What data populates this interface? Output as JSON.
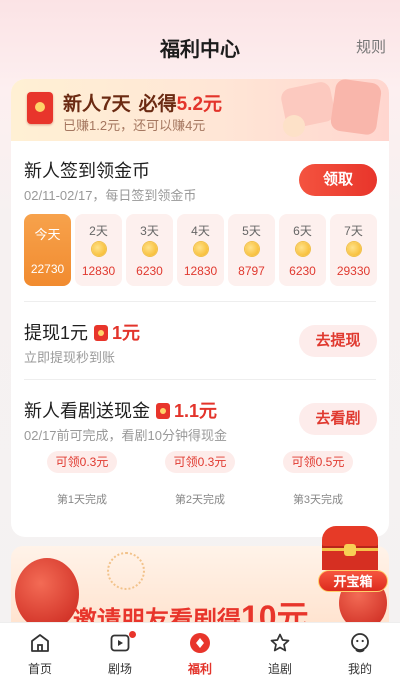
{
  "header": {
    "title": "福利中心",
    "rules": "规则"
  },
  "banner": {
    "line1_prefix": "新人7天",
    "line1_mid": "必得",
    "line1_amount": "5.2元",
    "line2": "已赚1.2元，还可以赚4元"
  },
  "signin": {
    "title": "新人签到领金币",
    "subtitle": "02/11-02/17，每日签到领金币",
    "button": "领取",
    "days": [
      {
        "day": "今天",
        "value": "22730"
      },
      {
        "day": "2天",
        "value": "12830"
      },
      {
        "day": "3天",
        "value": "6230"
      },
      {
        "day": "4天",
        "value": "12830"
      },
      {
        "day": "5天",
        "value": "8797"
      },
      {
        "day": "6天",
        "value": "6230"
      },
      {
        "day": "7天",
        "value": "29330"
      }
    ]
  },
  "withdraw": {
    "title": "提现1元",
    "amount": "1元",
    "subtitle": "立即提现秒到账",
    "button": "去提现"
  },
  "watch": {
    "title": "新人看剧送现金",
    "amount": "1.1元",
    "subtitle": "02/17前可完成，看剧10分钟得现金",
    "button": "去看剧",
    "steps": [
      {
        "reward": "可领0.3元",
        "label": "第1天完成"
      },
      {
        "reward": "可领0.3元",
        "label": "第2天完成"
      },
      {
        "reward": "可领0.5元",
        "label": "第3天完成"
      }
    ]
  },
  "invite": {
    "text": "邀请朋友看剧得",
    "amount": "10元"
  },
  "treasure": {
    "label": "开宝箱"
  },
  "tabs": [
    {
      "label": "首页",
      "icon": "home-icon"
    },
    {
      "label": "剧场",
      "icon": "theater-icon"
    },
    {
      "label": "福利",
      "icon": "welfare-icon"
    },
    {
      "label": "追剧",
      "icon": "follow-star-icon"
    },
    {
      "label": "我的",
      "icon": "profile-icon"
    }
  ],
  "colors": {
    "accent": "#e8352b",
    "orange": "#f18b2f"
  }
}
